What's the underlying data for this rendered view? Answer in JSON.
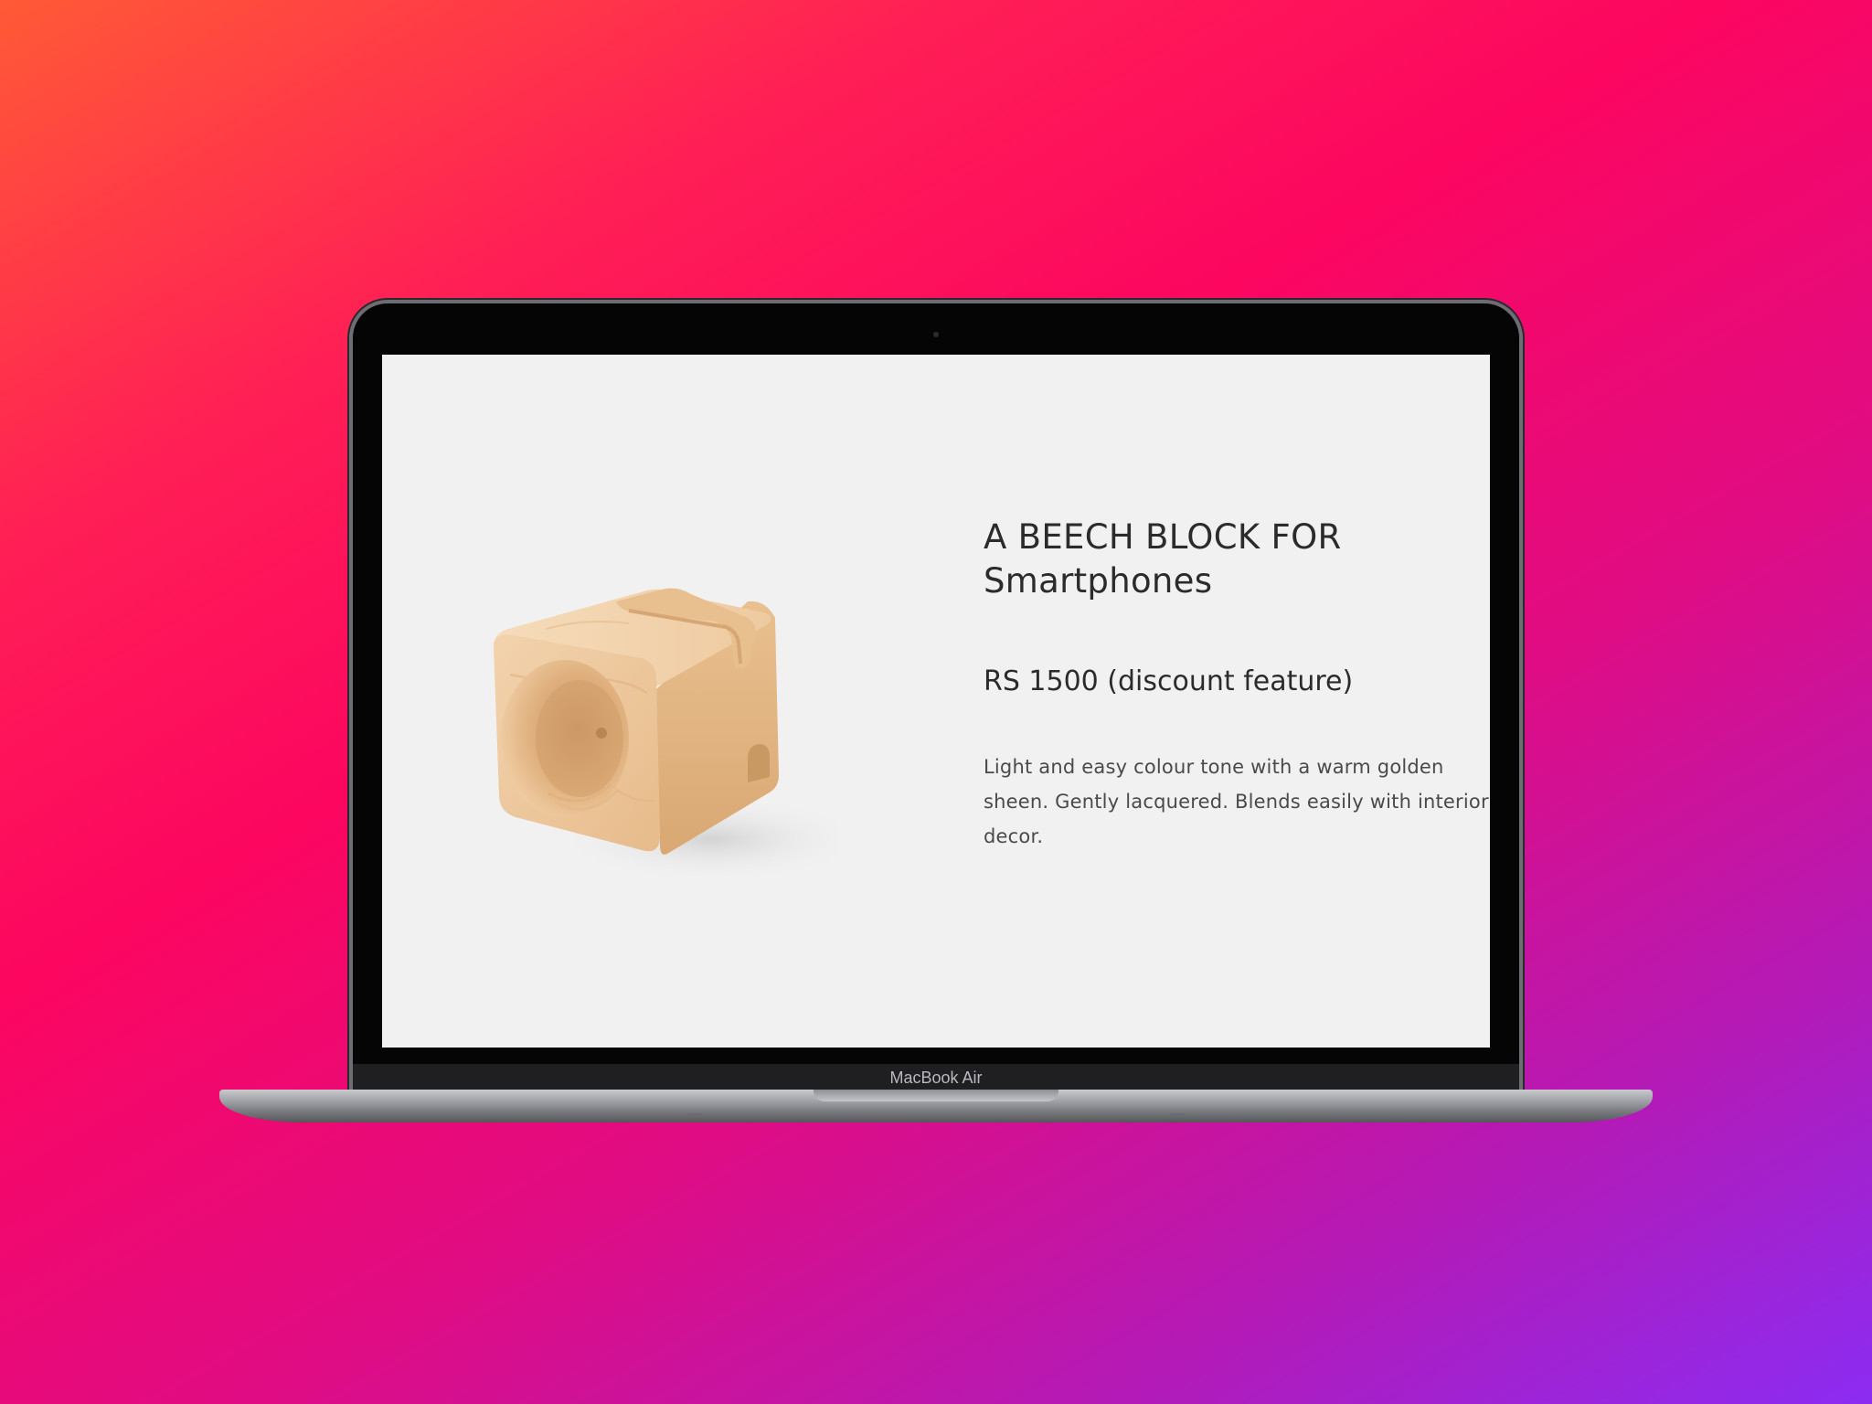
{
  "device": {
    "model_label": "MacBook Air"
  },
  "product": {
    "title_line1": "A BEECH BLOCK FOR",
    "title_line2": "Smartphones",
    "price": "RS 1500 (discount feature)",
    "description": "Light and easy colour tone with a warm golden sheen. Gently lacquered. Blends easily with interior decor.",
    "image": "wooden-phone-stand-cube"
  },
  "colors": {
    "background_gradient": [
      "#ff5a36",
      "#fc0660",
      "#8b2cf2"
    ],
    "screen_background": "#f1f1f1",
    "text": "#2b2b2b",
    "wood_light": "#f1cfa7",
    "wood_dark": "#c79a6c"
  }
}
